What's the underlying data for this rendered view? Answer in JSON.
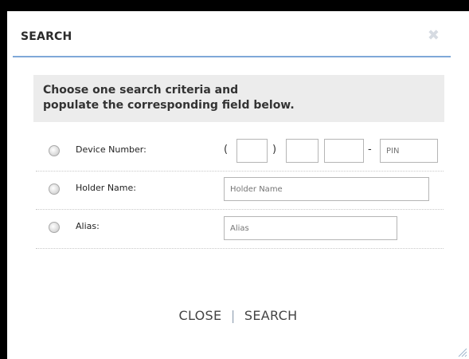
{
  "dialog": {
    "title": "SEARCH",
    "close_glyph": "✖"
  },
  "instructions": {
    "line1": "Choose one search criteria and",
    "line2": "populate the corresponding field below."
  },
  "fields": {
    "device_number": {
      "label": "Device Number:",
      "open_paren": "(",
      "close_paren": ")",
      "dash": "-",
      "area_value": "",
      "prefix_value": "",
      "line_value": "",
      "pin_placeholder": "PIN"
    },
    "holder_name": {
      "label": "Holder Name:",
      "placeholder": "Holder Name"
    },
    "alias": {
      "label": "Alias:",
      "placeholder": "Alias"
    }
  },
  "actions": {
    "close_label": "CLOSE",
    "separator": "|",
    "search_label": "SEARCH"
  },
  "colors": {
    "title_underline": "#7fa8d8",
    "instructions_bg": "#ececec"
  },
  "icons": {
    "close": "close-icon",
    "radio": "radio-button",
    "resize": "resize-grip-icon"
  }
}
